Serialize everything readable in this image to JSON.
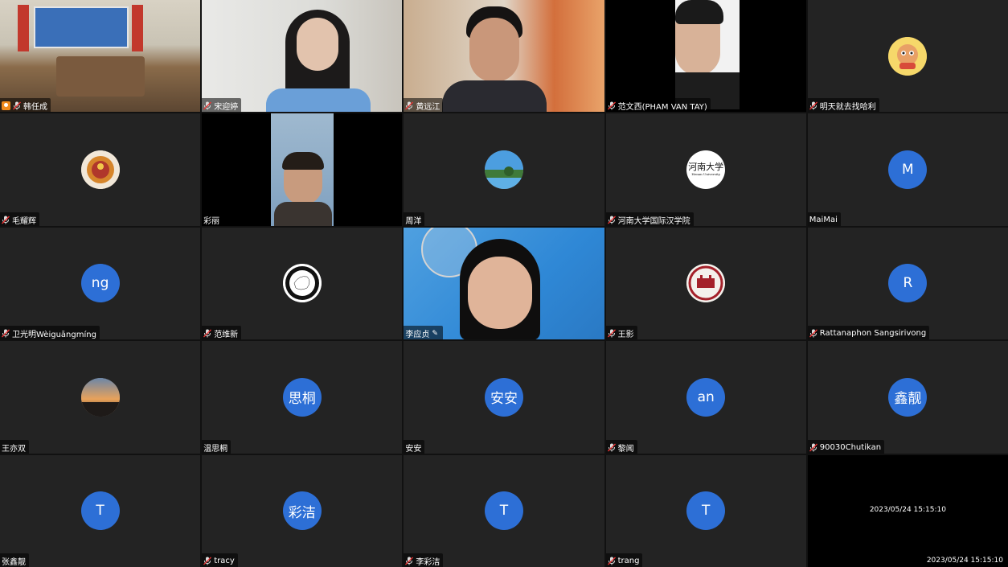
{
  "participants": [
    {
      "name": "韩任成",
      "kind": "video",
      "host": true
    },
    {
      "name": "宋迎婷",
      "kind": "video"
    },
    {
      "name": "黄远江",
      "kind": "video"
    },
    {
      "name": "范文西(PHAM VAN TAY)",
      "kind": "video"
    },
    {
      "name": "明天就去找哈利",
      "kind": "avatar-image",
      "icon": "cartoon-monkey-icon"
    },
    {
      "name": "毛耀辉",
      "kind": "avatar-image",
      "icon": "ornament-icon"
    },
    {
      "name": "彩丽",
      "kind": "video"
    },
    {
      "name": "周洋",
      "kind": "avatar-image",
      "icon": "landscape-photo-icon"
    },
    {
      "name": "河南大学国际汉学院",
      "kind": "avatar-image",
      "icon": "university-logo-icon",
      "logo_text": "河南大学",
      "logo_subtext": "Henan University"
    },
    {
      "name": "MaiMai",
      "kind": "initials",
      "initials": "M"
    },
    {
      "name": "卫光明Wèiguāngmíng",
      "kind": "initials",
      "initials": "ng"
    },
    {
      "name": "范维新",
      "kind": "avatar-image",
      "icon": "ink-circle-icon"
    },
    {
      "name": "李应贞",
      "kind": "video",
      "editable": true
    },
    {
      "name": "王影",
      "kind": "avatar-image",
      "icon": "red-seal-icon"
    },
    {
      "name": "Rattanaphon Sangsirivong",
      "kind": "initials",
      "initials": "R"
    },
    {
      "name": "王亦双",
      "kind": "avatar-image",
      "icon": "sunset-photo-icon"
    },
    {
      "name": "温思桐",
      "kind": "initials",
      "initials": "思桐"
    },
    {
      "name": "安安",
      "kind": "initials",
      "initials": "安安"
    },
    {
      "name": "黎闻",
      "kind": "initials",
      "initials": "an"
    },
    {
      "name": "90030Chutikan",
      "kind": "initials",
      "initials": "鑫靓"
    },
    {
      "name": "张鑫靓",
      "kind": "initials",
      "initials": "T"
    },
    {
      "name": "tracy",
      "kind": "initials",
      "initials": "彩洁"
    },
    {
      "name": "李彩洁",
      "kind": "initials",
      "initials": "T"
    },
    {
      "name": "trang",
      "kind": "initials",
      "initials": "T"
    },
    {
      "name": "",
      "kind": "timestamp",
      "timestamp_center": "2023/05/24 15:15:10",
      "timestamp_corner": "2023/05/24 15:15:10"
    }
  ],
  "colors": {
    "avatar_blue": "#2d6fd6",
    "tile_bg": "#232323",
    "speaking_outline": "#2fd05a"
  }
}
